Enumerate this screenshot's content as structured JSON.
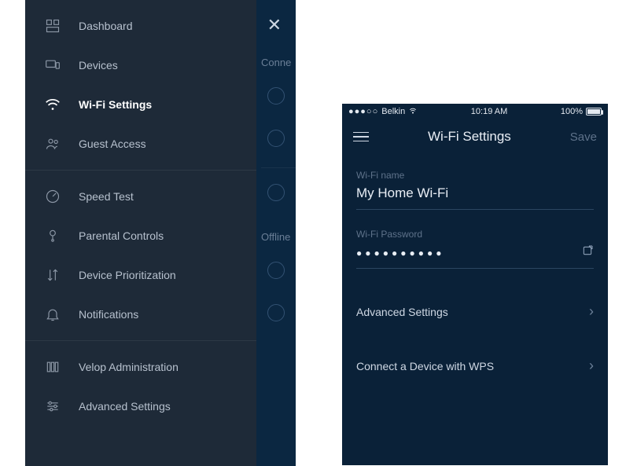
{
  "sidebar": {
    "items": [
      {
        "label": "Dashboard",
        "icon": "dashboard-icon"
      },
      {
        "label": "Devices",
        "icon": "devices-icon"
      },
      {
        "label": "Wi-Fi Settings",
        "icon": "wifi-icon",
        "active": true
      },
      {
        "label": "Guest Access",
        "icon": "people-icon"
      },
      {
        "label": "Speed Test",
        "icon": "gauge-icon"
      },
      {
        "label": "Parental Controls",
        "icon": "lock-icon"
      },
      {
        "label": "Device Prioritization",
        "icon": "arrows-icon"
      },
      {
        "label": "Notifications",
        "icon": "bell-icon"
      },
      {
        "label": "Velop Administration",
        "icon": "nodes-icon"
      },
      {
        "label": "Advanced Settings",
        "icon": "sliders-icon"
      }
    ]
  },
  "under_list": {
    "section1_label": "Conne",
    "section2_label": "Offline"
  },
  "phone": {
    "statusbar": {
      "carrier": "Belkin",
      "signal_dots": "●●●○○",
      "time": "10:19 AM",
      "battery_pct": "100%"
    },
    "navbar": {
      "title": "Wi-Fi Settings",
      "save": "Save"
    },
    "fields": {
      "name_label": "Wi-Fi name",
      "name_value": "My Home Wi-Fi",
      "pw_label": "Wi-Fi Password",
      "pw_value_masked": "●●●●●●●●●●"
    },
    "links": {
      "advanced": "Advanced Settings",
      "wps": "Connect a Device with WPS"
    }
  }
}
